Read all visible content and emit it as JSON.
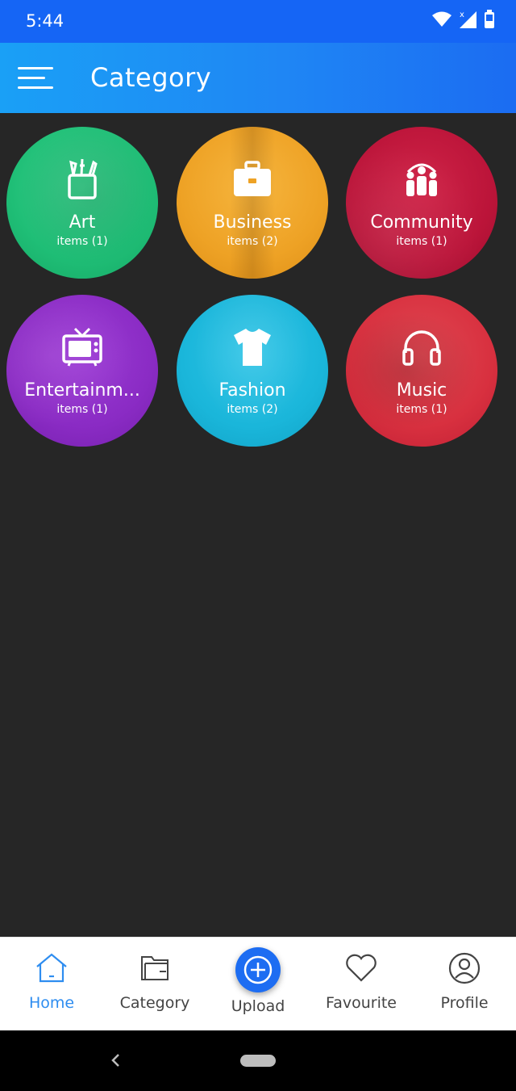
{
  "status_bar": {
    "time": "5:44"
  },
  "app_bar": {
    "title": "Category"
  },
  "colors": {
    "accent": "#1f86f4",
    "background": "#262626"
  },
  "categories": [
    {
      "name": "Art",
      "count": "items (1)",
      "color": "#21c07a",
      "icon": "art-supplies-icon"
    },
    {
      "name": "Business",
      "count": "items (2)",
      "color": "#f0a322",
      "icon": "briefcase-icon"
    },
    {
      "name": "Community",
      "count": "items (1)",
      "color": "#c2173c",
      "icon": "people-group-icon"
    },
    {
      "name": "Entertainm...",
      "count": "items (1)",
      "color": "#8a2bc4",
      "icon": "tv-icon"
    },
    {
      "name": "Fashion",
      "count": "items (2)",
      "color": "#1ab6da",
      "icon": "tshirt-icon"
    },
    {
      "name": "Music",
      "count": "items (1)",
      "color": "#d8303f",
      "icon": "headphones-icon"
    }
  ],
  "bottom_nav": {
    "items": [
      {
        "label": "Home",
        "icon": "home-icon",
        "active": true
      },
      {
        "label": "Category",
        "icon": "folder-icon",
        "active": false
      },
      {
        "label": "Upload",
        "icon": "plus-circle-icon",
        "active": false
      },
      {
        "label": "Favourite",
        "icon": "heart-icon",
        "active": false
      },
      {
        "label": "Profile",
        "icon": "user-circle-icon",
        "active": false
      }
    ]
  }
}
